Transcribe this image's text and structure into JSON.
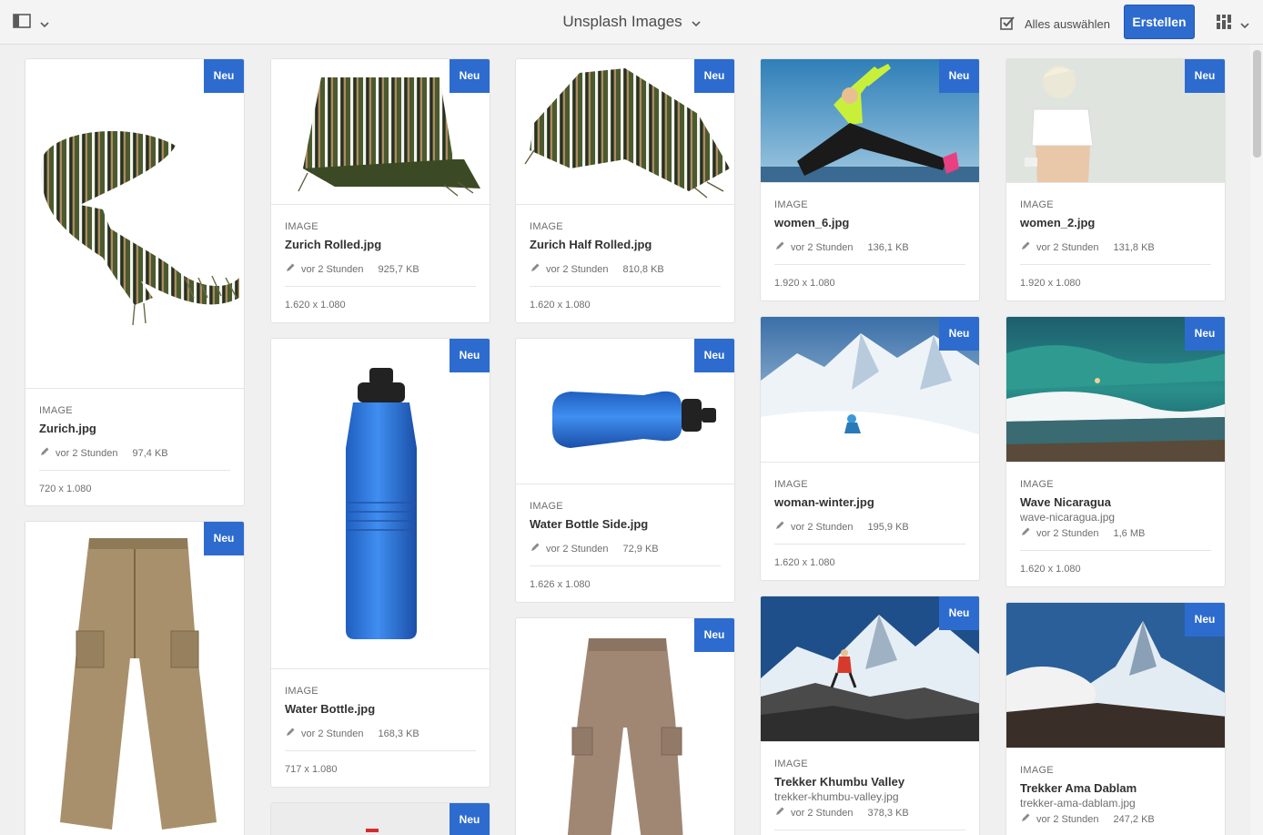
{
  "header": {
    "title": "Unsplash Images",
    "select_all": "Alles auswählen",
    "create": "Erstellen"
  },
  "cards": [
    {
      "badge": "Neu",
      "type": "IMAGE",
      "name": "Zurich.jpg",
      "modified": "vor 2 Stunden",
      "size": "97,4 KB",
      "dimensions": "720 x 1.080"
    },
    {
      "badge": "Neu"
    },
    {
      "badge": "Neu",
      "type": "IMAGE",
      "name": "Zurich Rolled.jpg",
      "modified": "vor 2 Stunden",
      "size": "925,7 KB",
      "dimensions": "1.620 x 1.080"
    },
    {
      "badge": "Neu",
      "type": "IMAGE",
      "name": "Water Bottle.jpg",
      "modified": "vor 2 Stunden",
      "size": "168,3 KB",
      "dimensions": "717 x 1.080"
    },
    {
      "badge": "Neu"
    },
    {
      "badge": "Neu",
      "type": "IMAGE",
      "name": "Zurich Half Rolled.jpg",
      "modified": "vor 2 Stunden",
      "size": "810,8 KB",
      "dimensions": "1.620 x 1.080"
    },
    {
      "badge": "Neu",
      "type": "IMAGE",
      "name": "Water Bottle Side.jpg",
      "modified": "vor 2 Stunden",
      "size": "72,9 KB",
      "dimensions": "1.626 x 1.080"
    },
    {
      "badge": "Neu"
    },
    {
      "badge": "Neu",
      "type": "IMAGE",
      "name": "women_6.jpg",
      "modified": "vor 2 Stunden",
      "size": "136,1 KB",
      "dimensions": "1.920 x 1.080"
    },
    {
      "badge": "Neu",
      "type": "IMAGE",
      "name": "woman-winter.jpg",
      "modified": "vor 2 Stunden",
      "size": "195,9 KB",
      "dimensions": "1.620 x 1.080"
    },
    {
      "badge": "Neu",
      "type": "IMAGE",
      "name": "Trekker Khumbu Valley",
      "file": "trekker-khumbu-valley.jpg",
      "modified": "vor 2 Stunden",
      "size": "378,3 KB"
    },
    {
      "badge": "Neu",
      "type": "IMAGE",
      "name": "women_2.jpg",
      "modified": "vor 2 Stunden",
      "size": "131,8 KB",
      "dimensions": "1.920 x 1.080"
    },
    {
      "badge": "Neu",
      "type": "IMAGE",
      "name": "Wave Nicaragua",
      "file": "wave-nicaragua.jpg",
      "modified": "vor 2 Stunden",
      "size": "1,6 MB",
      "dimensions": "1.620 x 1.080"
    },
    {
      "badge": "Neu",
      "type": "IMAGE",
      "name": "Trekker Ama Dablam",
      "file": "trekker-ama-dablam.jpg",
      "modified": "vor 2 Stunden",
      "size": "247,2 KB"
    }
  ]
}
